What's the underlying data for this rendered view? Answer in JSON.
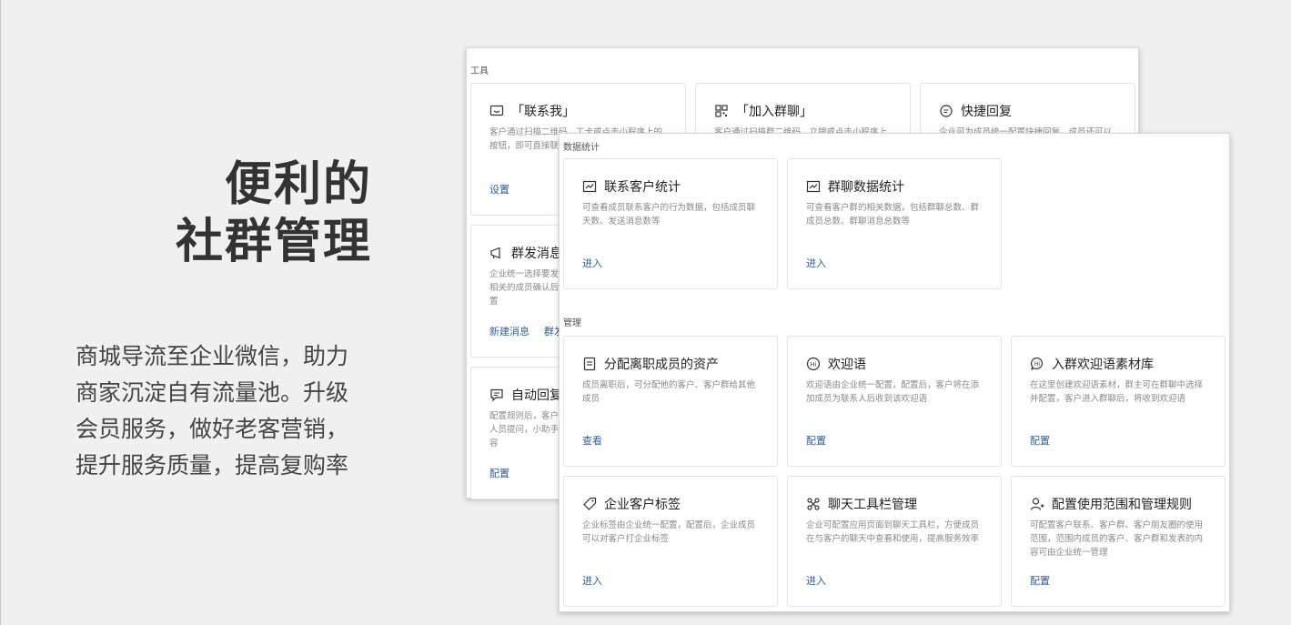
{
  "headline": {
    "line1": "便利的",
    "line2": "社群管理"
  },
  "description": {
    "line1": "商城导流至企业微信，助力",
    "line2": "商家沉淀自有流量池。升级",
    "line3": "会员服务，做好老客营销，",
    "line4": "提升服务质量，提高复购率"
  },
  "back_panel": {
    "section": "工具",
    "cards": [
      {
        "title": "「联系我」",
        "icon": "message-square-icon",
        "desc": "客户通过扫描二维码、工卡或点击小程序上的按钮，即可直接联系到成员",
        "actions": [
          "设置"
        ]
      },
      {
        "title": "「加入群聊」",
        "icon": "qr-code-icon",
        "desc": "客户通过扫描群二维码、立牌或点击小程序上的按钮，即可加入群聊",
        "actions": []
      },
      {
        "title": "快捷回复",
        "icon": "chat-bubble-icon",
        "desc": "企业可为成员统一配置快捷回复，成员还可以自定义",
        "actions": []
      },
      {
        "title": "群发消息",
        "icon": "megaphone-icon",
        "desc": "企业统一选择要发送的客户和消息内容，通知相关的成员确认后发送。管理员和负责人可设置",
        "actions": [
          "新建消息",
          "群发记录"
        ]
      },
      {
        "title": "自动回复",
        "icon": "auto-reply-icon",
        "desc": "配置规则后，客户在群聊中@群主或智能助手人员提问，小助手将自动回复配置好的消息内容",
        "actions": [
          "配置"
        ]
      }
    ]
  },
  "front_panel": {
    "section_stats": "数据统计",
    "section_manage": "管理",
    "cards": [
      {
        "title": "联系客户统计",
        "icon": "line-chart-icon",
        "desc": "可查看成员联系客户的行为数据，包括成员聊天数、发送消息数等",
        "action": "进入"
      },
      {
        "title": "群聊数据统计",
        "icon": "line-chart-icon",
        "desc": "可查看客户群的相关数据，包括群聊总数、群成员总数、群聊消息总数等",
        "action": "进入"
      },
      {
        "title": "分配离职成员的资产",
        "icon": "assign-doc-icon",
        "desc": "成员离职后，可分配他的客户、客户群给其他成员",
        "action": "查看"
      },
      {
        "title": "欢迎语",
        "icon": "hi-badge-icon",
        "desc": "欢迎语由企业统一配置，配置后，客户将在添加成员为联系人后收到该欢迎语",
        "action": "配置"
      },
      {
        "title": "入群欢迎语素材库",
        "icon": "hi-bubble-icon",
        "desc": "在这里创建欢迎语素材，群主可在群聊中选择并配置，客户进入群聊后，将收到欢迎语",
        "action": "配置"
      },
      {
        "title": "企业客户标签",
        "icon": "tag-icon",
        "desc": "企业标签由企业统一配置，配置后，企业成员可以对客户打企业标签",
        "action": "进入"
      },
      {
        "title": "聊天工具栏管理",
        "icon": "command-icon",
        "desc": "企业可配置应用页面到聊天工具栏，方便成员在与客户的聊天中查看和使用，提高服务效率",
        "action": "进入"
      },
      {
        "title": "配置使用范围和管理规则",
        "icon": "user-plus-icon",
        "desc": "可配置客户联系、客户群、客户朋友圈的使用范围，范围内成员的客户、客户群和发表的内容可由企业统一管理",
        "action": "配置"
      }
    ]
  }
}
